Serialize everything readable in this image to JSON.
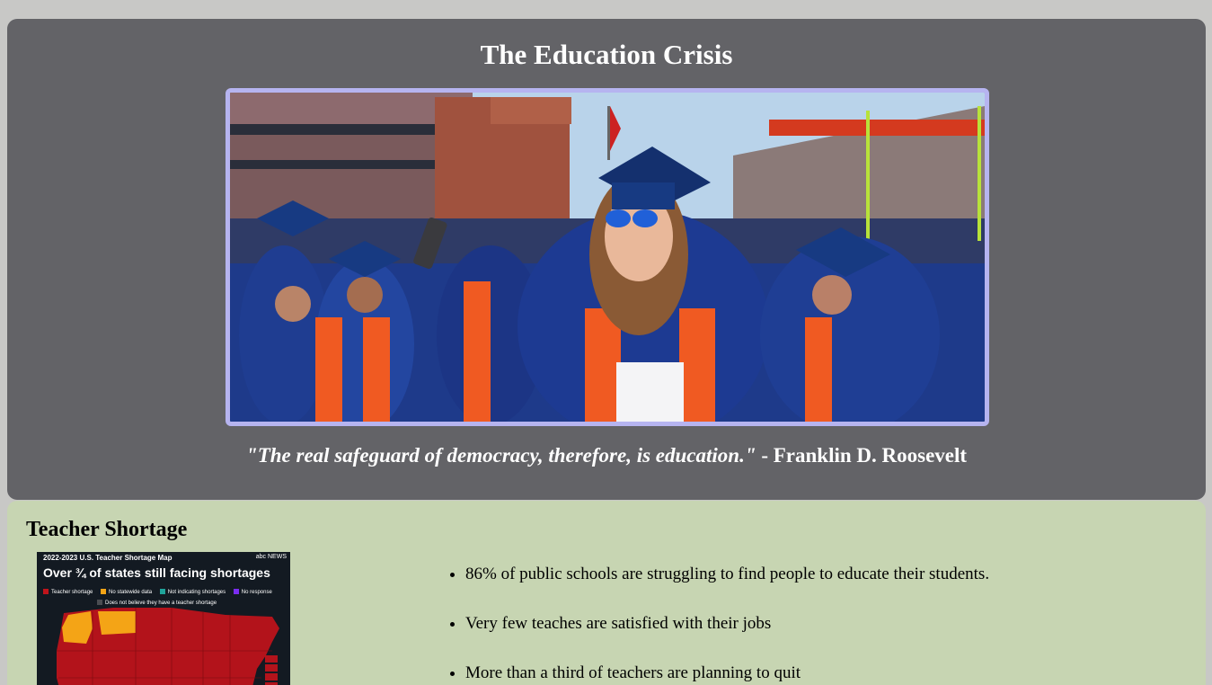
{
  "hero": {
    "title": "The Education Crisis",
    "image_alt": "graduation-photo",
    "quote_text": "\"The real safeguard of democracy, therefore, is education.\"",
    "quote_author": " - Franklin D. Roosevelt"
  },
  "teacher_shortage": {
    "title": "Teacher Shortage",
    "map": {
      "header": "2022-2023 U.S. Teacher Shortage Map",
      "brand": "abc NEWS",
      "headline": "Over ¾ of states still facing shortages",
      "legend": [
        {
          "label": "Teacher shortage",
          "color": "#c0141b"
        },
        {
          "label": "No statewide data",
          "color": "#f4a416"
        },
        {
          "label": "Not indicating shortages",
          "color": "#1fa39a"
        },
        {
          "label": "No response",
          "color": "#7a2cf0"
        },
        {
          "label": "Does not believe they have a teacher shortage",
          "color": "#4a4d52"
        }
      ]
    },
    "bullets": [
      "86% of public schools are struggling to find people to educate their students.",
      "Very few teaches are satisfied with their jobs",
      "More than a third of teachers are planning to quit"
    ]
  },
  "colors": {
    "page_bg": "#c8c8c6",
    "hero_bg": "#636367",
    "frame_border": "#b6b4f0",
    "panel_bg": "#c7d5b2"
  }
}
